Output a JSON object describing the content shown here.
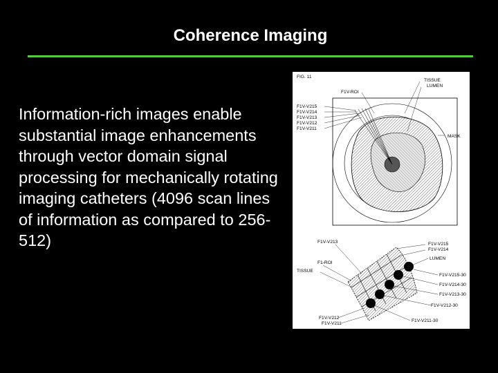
{
  "slide": {
    "title": "Coherence Imaging",
    "body": "Information-rich images enable substantial image enhancements through vector domain signal processing for mechanically rotating imaging catheters (4096 scan lines of information as compared to 256-512)"
  },
  "figure": {
    "fig_label": "FIG. 11",
    "top_labels": {
      "tissue": "TISSUE",
      "lumen": "LUMEN",
      "roi": "F1V-ROI",
      "mask": "MASK",
      "vectors": [
        "F1V-V215",
        "F1V-V214",
        "F1V-V213",
        "F1V-V212",
        "F1V-V211"
      ]
    },
    "bottom_labels": {
      "v213": "F1V-V213",
      "roi": "F1-ROI",
      "tissue": "TISSUE",
      "v215": "F1V-V215",
      "v214": "F1V-V214",
      "lumen": "LUMEN",
      "v215_30": "F1V-V215-30",
      "v214_30": "F1V-V214-30",
      "v213_30": "F1V-V213-30",
      "v212_30": "F1V-V212-30",
      "v211_30": "F1V-V211-30",
      "v212": "F1V-V212",
      "v211": "F1V-V211"
    }
  },
  "colors": {
    "background": "#000000",
    "rule": "#52cc3a",
    "text": "#ffffff"
  }
}
